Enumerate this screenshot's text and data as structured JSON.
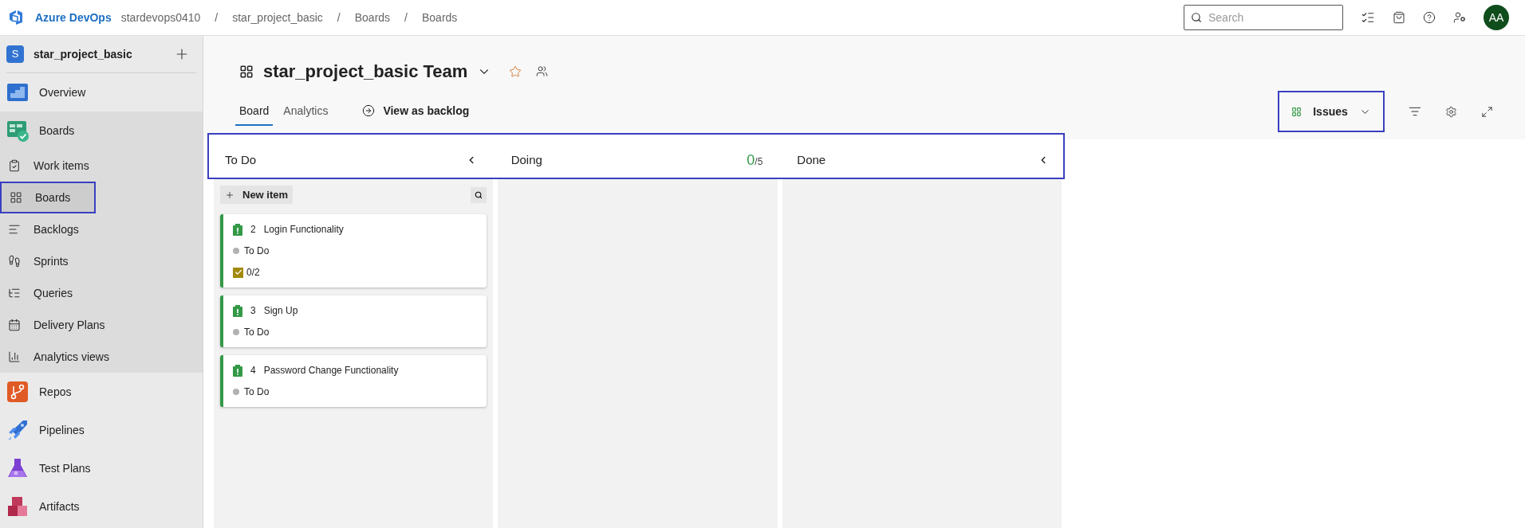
{
  "topbar": {
    "product": "Azure DevOps",
    "breadcrumbs": [
      {
        "label": "stardevops0410"
      },
      {
        "separator": "/",
        "label": "star_project_basic"
      },
      {
        "separator": "/",
        "label": "Boards"
      },
      {
        "separator": "/",
        "label": "Boards"
      }
    ],
    "search": {
      "placeholder": "Search"
    },
    "avatar": "AA"
  },
  "sidebar": {
    "project": {
      "initial": "S",
      "name": "star_project_basic"
    },
    "items": [
      {
        "label": "Overview",
        "kind": "overview",
        "expanded": false,
        "outlined": false
      },
      {
        "label": "Boards",
        "kind": "boards",
        "expanded": true,
        "outlined": false,
        "children": [
          {
            "label": "Work items",
            "kind": "workitems",
            "selected": false,
            "outlined": false
          },
          {
            "label": "Boards",
            "kind": "board",
            "selected": true,
            "outlined": true
          },
          {
            "label": "Backlogs",
            "kind": "backlogs",
            "selected": false,
            "outlined": false
          },
          {
            "label": "Sprints",
            "kind": "sprints",
            "selected": false,
            "outlined": false
          },
          {
            "label": "Queries",
            "kind": "queries",
            "selected": false,
            "outlined": false
          },
          {
            "label": "Delivery Plans",
            "kind": "plans",
            "selected": false,
            "outlined": false
          },
          {
            "label": "Analytics views",
            "kind": "analytics",
            "selected": false,
            "outlined": false
          }
        ]
      },
      {
        "label": "Repos",
        "kind": "repos",
        "expanded": false,
        "outlined": false
      },
      {
        "label": "Pipelines",
        "kind": "pipelines",
        "expanded": false,
        "outlined": false
      },
      {
        "label": "Test Plans",
        "kind": "testplans",
        "expanded": false,
        "outlined": false
      },
      {
        "label": "Artifacts",
        "kind": "artifacts",
        "expanded": false,
        "outlined": false
      }
    ]
  },
  "header": {
    "team": "star_project_basic Team",
    "tabs": [
      {
        "label": "Board",
        "selected": true
      },
      {
        "label": "Analytics",
        "selected": false
      }
    ],
    "view_as_backlog": "View as backlog",
    "backlog_level": {
      "label": "Issues",
      "outlined": true
    }
  },
  "board": {
    "header_outlined": true,
    "new_item": "New item",
    "columns": [
      {
        "title": "To Do",
        "collapsible": true,
        "cards": [
          {
            "id": "2",
            "title": "Login Functionality",
            "state": "To Do",
            "tasks": "0/2"
          },
          {
            "id": "3",
            "title": "Sign Up",
            "state": "To Do"
          },
          {
            "id": "4",
            "title": "Password Change Functionality",
            "state": "To Do"
          }
        ]
      },
      {
        "title": "Doing",
        "collapsible": false,
        "wip_count": "0",
        "wip_limit": "/5"
      },
      {
        "title": "Done",
        "collapsible": true
      }
    ]
  }
}
